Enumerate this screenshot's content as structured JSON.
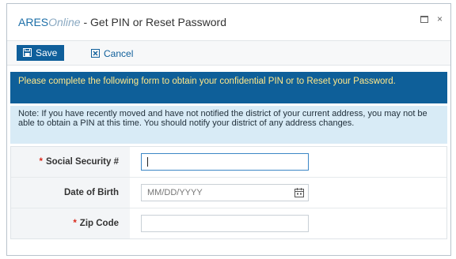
{
  "window": {
    "brand": "ARES",
    "brand_suffix": "Online",
    "title": " - Get PIN or Reset Password",
    "maximize_icon": "maximize-icon",
    "close_glyph": "×"
  },
  "toolbar": {
    "save_label": "Save",
    "cancel_label": "Cancel",
    "save_icon": "save-icon",
    "cancel_icon": "cancel-icon"
  },
  "banner": {
    "text": "Please complete the following form to obtain your confidential PIN or to Reset your Password."
  },
  "note": {
    "text": "Note: If you have recently moved and have not notified the district of your current address, you may not be able to obtain a PIN at this time. You should notify your district of any address changes."
  },
  "form": {
    "ssn_required": "*",
    "ssn_label": "Social Security #",
    "ssn_value": "",
    "dob_label": "Date of Birth",
    "dob_placeholder": "MM/DD/YYYY",
    "dob_icon": "calendar-icon",
    "zip_required": "*",
    "zip_label": "Zip Code",
    "zip_value": ""
  },
  "colors": {
    "accent": "#0f5f9b",
    "banner_bg": "#0e5f99",
    "banner_text": "#ffe88a",
    "note_bg": "#d8ebf6",
    "required": "#d9291c"
  }
}
